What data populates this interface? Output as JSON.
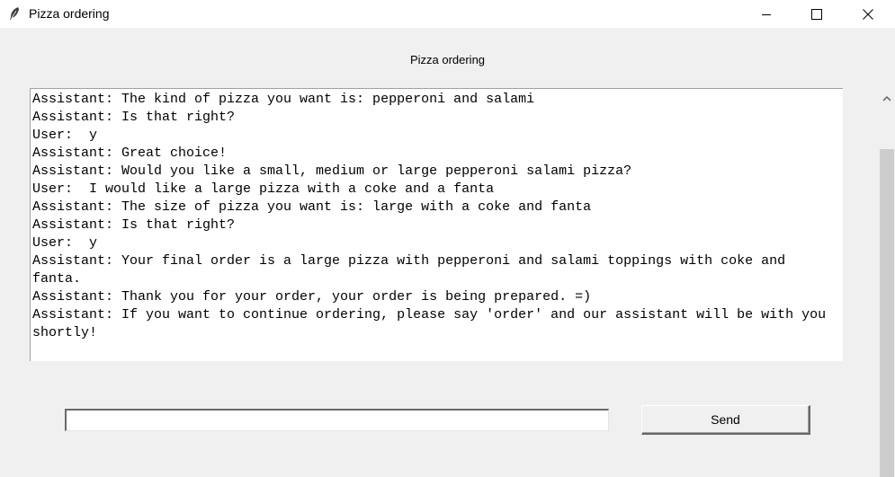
{
  "window": {
    "title": "Pizza ordering",
    "icon": "feather-icon",
    "controls": [
      "minimize-icon",
      "maximize-icon",
      "close-icon"
    ]
  },
  "header": {
    "label": "Pizza ordering"
  },
  "chat": {
    "lines": [
      "Assistant: The kind of pizza you want is: pepperoni and salami",
      "Assistant: Is that right?",
      "User:  y",
      "Assistant: Great choice!",
      "Assistant: Would you like a small, medium or large pepperoni salami pizza?",
      "User:  I would like a large pizza with a coke and a fanta",
      "Assistant: The size of pizza you want is: large with a coke and fanta",
      "Assistant: Is that right?",
      "User:  y",
      "Assistant: Your final order is a large pizza with pepperoni and salami toppings with coke and fanta.",
      "Assistant: Thank you for your order, your order is being prepared. =)",
      "Assistant: If you want to continue ordering, please say 'order' and our assistant will be with you shortly!"
    ]
  },
  "input": {
    "value": ""
  },
  "send": {
    "label": "Send"
  }
}
